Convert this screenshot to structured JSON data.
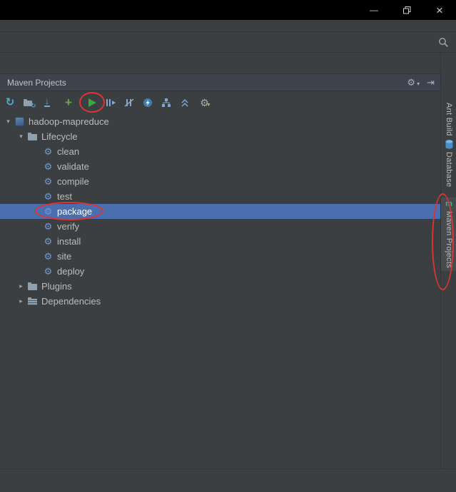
{
  "window_controls": {
    "minimize_glyph": "—",
    "close_glyph": "×",
    "icons": [
      "minimize-icon",
      "restore-icon",
      "close-icon"
    ]
  },
  "top_bar": {
    "icons": [
      "search-icon"
    ]
  },
  "panel": {
    "title": "Maven Projects",
    "header_icons": [
      "settings-gear-icon",
      "dropdown-arrow-icon",
      "hide-panel-icon"
    ],
    "toolbar_icons": [
      "reimport-icon",
      "generate-sources-icon",
      "download-sources-icon",
      "add-maven-project-icon",
      "run-build-icon",
      "execute-goal-icon",
      "toggle-skip-tests-icon",
      "toggle-offline-icon",
      "show-dependencies-icon",
      "collapse-all-icon",
      "maven-settings-icon"
    ]
  },
  "glyphs": {
    "arrow_expanded": "▾",
    "arrow_collapsed": "▸",
    "goal_gear": "⚙",
    "reimport": "↻",
    "download": "↓",
    "plus": "+",
    "settings_gear": "⚙",
    "funnel": "▼",
    "dropdown": "▾",
    "hide": "⇥",
    "maven_m": "m"
  },
  "tree": {
    "items": [
      {
        "label": "hadoop-mapreduce",
        "type": "project",
        "expanded": true
      },
      {
        "label": "Lifecycle",
        "type": "folder",
        "expanded": true
      },
      {
        "label": "clean",
        "type": "goal"
      },
      {
        "label": "validate",
        "type": "goal"
      },
      {
        "label": "compile",
        "type": "goal"
      },
      {
        "label": "test",
        "type": "goal"
      },
      {
        "label": "package",
        "type": "goal",
        "selected": true
      },
      {
        "label": "verify",
        "type": "goal"
      },
      {
        "label": "install",
        "type": "goal"
      },
      {
        "label": "site",
        "type": "goal"
      },
      {
        "label": "deploy",
        "type": "goal"
      },
      {
        "label": "Plugins",
        "type": "folder",
        "expanded": false
      },
      {
        "label": "Dependencies",
        "type": "folder",
        "expanded": false
      }
    ]
  },
  "right_tabs": {
    "items": [
      {
        "label": "Ant Build"
      },
      {
        "label": "Database",
        "icon": "database-icon"
      },
      {
        "label": "Maven Projects",
        "icon": "maven-icon",
        "active": true
      }
    ]
  },
  "annotations": {
    "color": "#dd3333",
    "shapes": [
      "run-build-circle",
      "package-goal-circle",
      "maven-projects-tab-circle"
    ]
  },
  "colors": {
    "background": "#3c3f41",
    "titlebar": "#000000",
    "selection": "#4b6eaf",
    "tree_text": "#bcbcbc",
    "goal_icon_blue": "#6e9bd4",
    "run_green": "#43a047",
    "add_green": "#65aa3f",
    "annotation_red": "#dd3333"
  }
}
